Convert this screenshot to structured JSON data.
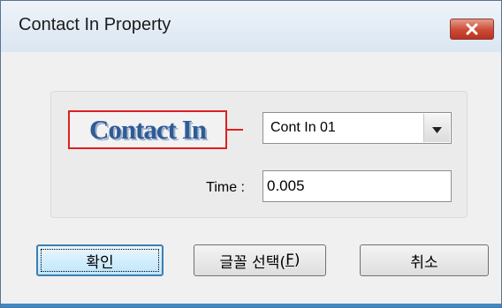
{
  "window": {
    "title": "Contact In Property"
  },
  "contact_label": {
    "text": "Contact In"
  },
  "contact_select": {
    "value": "Cont In 01"
  },
  "time": {
    "label": "Time :",
    "value": "0.005"
  },
  "buttons": {
    "ok": "확인",
    "font_prefix": "글꼴 선택(",
    "font_mnemonic": "F",
    "font_suffix": ")",
    "cancel": "취소"
  },
  "colors": {
    "label_border": "#e02020",
    "label_text": "#2f5b97",
    "close_button": "#cc4a36",
    "frame_accent": "#3d8bc6"
  },
  "icons": {
    "close": "close-x-icon",
    "dropdown": "triangle-down-icon"
  }
}
